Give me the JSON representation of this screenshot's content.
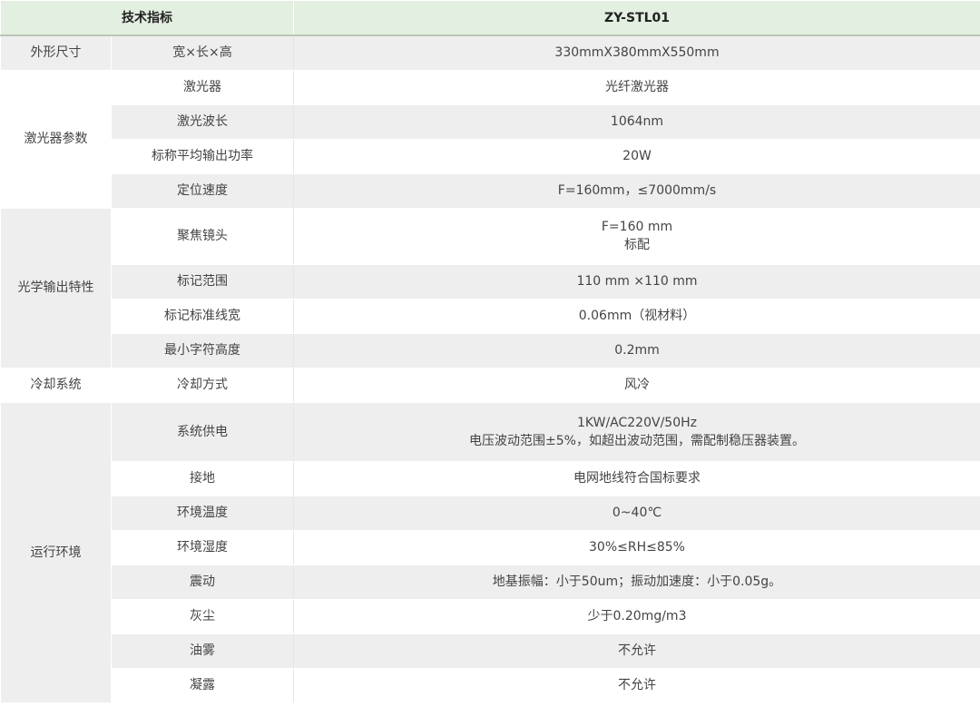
{
  "header": {
    "left": "技术指标",
    "right": "ZY-STL01"
  },
  "rows": {
    "size": {
      "group": "外形尺寸",
      "label": "宽×长×高",
      "value": "330mmX380mmX550mm"
    },
    "laser": {
      "group": "激光器参数",
      "items": [
        {
          "label": "激光器",
          "value": "光纤激光器"
        },
        {
          "label": "激光波长",
          "value": "1064nm"
        },
        {
          "label": "标称平均输出功率",
          "value": "20W"
        },
        {
          "label": "定位速度",
          "value": "F=160mm，≤7000mm/s"
        }
      ]
    },
    "optics": {
      "group": "光学输出特性",
      "items": [
        {
          "label": "聚焦镜头",
          "value": "F=160 mm",
          "value2": "标配"
        },
        {
          "label": "标记范围",
          "value": "110 mm ×110 mm"
        },
        {
          "label": "标记标准线宽",
          "value": "0.06mm（视材料）"
        },
        {
          "label": "最小字符高度",
          "value": "0.2mm"
        }
      ]
    },
    "cooling": {
      "group": "冷却系统",
      "label": "冷却方式",
      "value": "风冷"
    },
    "env": {
      "group": "运行环境",
      "items": [
        {
          "label": "系统供电",
          "value": "1KW/AC220V/50Hz",
          "value2": "电压波动范围±5%，如超出波动范围，需配制稳压器装置。"
        },
        {
          "label": "接地",
          "value": "电网地线符合国标要求"
        },
        {
          "label": "环境温度",
          "value": "0~40℃"
        },
        {
          "label": "环境湿度",
          "value": "30%≤RH≤85%"
        },
        {
          "label": "震动",
          "value": "地基振幅：小于50um；振动加速度：小于0.05g。"
        },
        {
          "label": "灰尘",
          "value": "少于0.20mg/m3"
        },
        {
          "label": "油雾",
          "value": "不允许"
        },
        {
          "label": "凝露",
          "value": "不允许"
        }
      ]
    }
  }
}
